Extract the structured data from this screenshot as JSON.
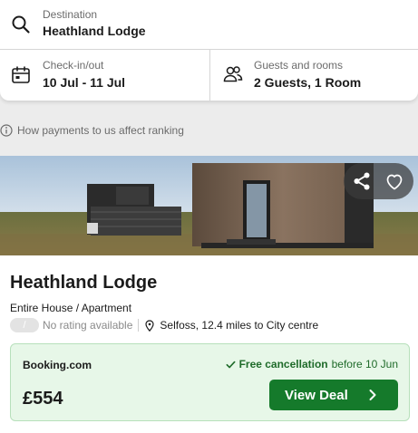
{
  "search": {
    "destination_label": "Destination",
    "destination_value": "Heathland Lodge",
    "dates_label": "Check-in/out",
    "dates_value": "10 Jul - 11 Jul",
    "guests_label": "Guests and rooms",
    "guests_value": "2 Guests, 1 Room"
  },
  "notice": {
    "ranking_text": "How payments to us affect ranking"
  },
  "result": {
    "name": "Heathland Lodge",
    "type": "Entire House / Apartment",
    "rating_badge": "/",
    "rating_text": "No rating available",
    "location": "Selfoss, 12.4 miles to City centre",
    "deal": {
      "provider": "Booking.com",
      "free_cancellation": "Free cancellation",
      "cancellation_date": "before 10 Jun",
      "price": "£554",
      "button_label": "View Deal"
    }
  },
  "colors": {
    "accent_green": "#157a2b",
    "deal_background": "#e7f7e8",
    "cancel_text": "#1f6b2a"
  },
  "icons": {
    "destination": "search-icon",
    "dates": "calendar-icon",
    "guests": "people-icon",
    "ranking": "info-icon",
    "share": "share-icon",
    "favorite": "heart-icon",
    "location": "map-pin-icon",
    "cancellation": "check-icon",
    "deal": "chevron-right-icon"
  }
}
